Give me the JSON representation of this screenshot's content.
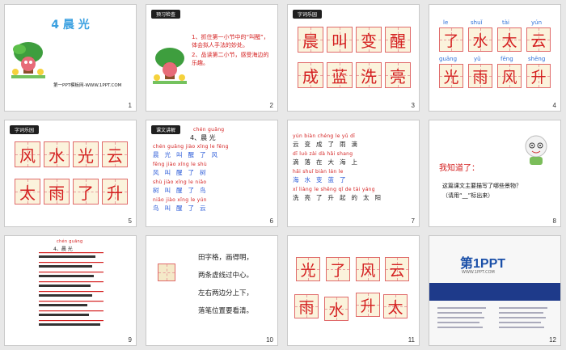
{
  "slides": [
    {
      "n": "1",
      "title": "4 晨 光",
      "site": "第一PPT模板网-WWW.1PPT.COM"
    },
    {
      "n": "2",
      "tag": "预习检查",
      "items": [
        "1、抓住第一小节中的“叫醒”，体会拟人手法的妙处。",
        "2、品读第二小节，感受海边的乐趣。"
      ]
    },
    {
      "n": "3",
      "tag": "字词乐园",
      "chars": [
        "晨",
        "叫",
        "变",
        "醒",
        "成",
        "蓝",
        "洗",
        "亮"
      ]
    },
    {
      "n": "4",
      "chars": [
        {
          "py": "le",
          "c": "了"
        },
        {
          "py": "shuǐ",
          "c": "水"
        },
        {
          "py": "tài",
          "c": "太"
        },
        {
          "py": "yún",
          "c": "云"
        },
        {
          "py": "guāng",
          "c": "光"
        },
        {
          "py": "yǔ",
          "c": "雨"
        },
        {
          "py": "fēng",
          "c": "风"
        },
        {
          "py": "shēng",
          "c": "升"
        }
      ]
    },
    {
      "n": "5",
      "tag": "字词乐园",
      "chars": [
        "风",
        "水",
        "光",
        "云",
        "太",
        "雨",
        "了",
        "升"
      ]
    },
    {
      "n": "6",
      "tag": "课文讲解",
      "heading_py": "chén guāng",
      "heading": "4、晨 光",
      "lines": [
        {
          "py": "chén guāng jiào xǐng le fēng",
          "cn": "晨光叫醒了风"
        },
        {
          "py": "fēng jiào xǐng le shù",
          "cn": "风叫醒了树"
        },
        {
          "py": "shù jiào xǐng le niǎo",
          "cn": "树叫醒了鸟"
        },
        {
          "py": "niǎo jiào xǐng le yún",
          "cn": "鸟叫醒了云"
        }
      ]
    },
    {
      "n": "7",
      "lines": [
        {
          "py": "yún biàn chéng le yǔ dī",
          "cn": "云变成了雨滴"
        },
        {
          "py": "dī luò zài dà hǎi shang",
          "cn": "滴落在大海上"
        },
        {
          "py": "hǎi shuǐ biàn lán le",
          "cn": "海水变蓝了"
        },
        {
          "py": "xǐ liàng le shēng qǐ de tài yáng",
          "cn": "洗亮了升起的太阳"
        }
      ]
    },
    {
      "n": "8",
      "know": "我知道了：",
      "q": "这篇课文主要描写了哪些景物？",
      "hint": "（请用“__”标出来）"
    },
    {
      "n": "9",
      "heading_py": "chén guāng",
      "heading": "4、晨 光"
    },
    {
      "n": "10",
      "rhyme": [
        "田字格，画得明，",
        "两条虚线过中心。",
        "左右两边分上下，",
        "落笔位置要看清。"
      ]
    },
    {
      "n": "11",
      "chars": [
        "光",
        "了",
        "风",
        "云",
        "雨",
        "水",
        "升",
        "太"
      ]
    },
    {
      "n": "12",
      "logo": "第1PPT",
      "sub": "WWW.1PPT.COM"
    }
  ]
}
